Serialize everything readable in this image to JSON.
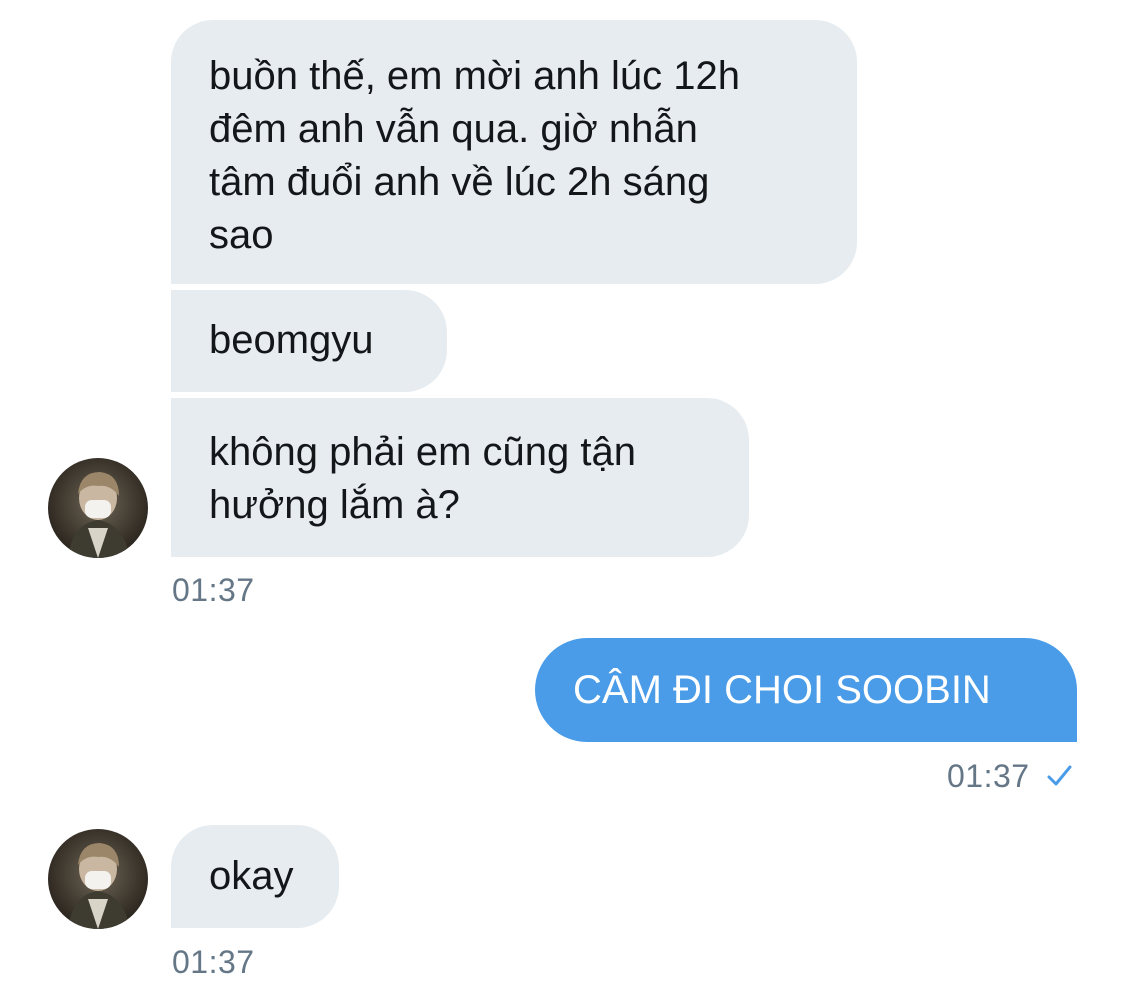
{
  "conversation": {
    "messages": [
      {
        "id": "m1",
        "direction": "incoming",
        "text": "buồn thế, em mời anh lúc 12h\nđêm anh vẫn qua. giờ nhẫn\ntâm đuổi anh về lúc 2h sáng\nsao"
      },
      {
        "id": "m2",
        "direction": "incoming",
        "text": "beomgyu"
      },
      {
        "id": "m3",
        "direction": "incoming",
        "text": "không phải em cũng tận\nhưởng lắm à?"
      },
      {
        "id": "m4",
        "direction": "outgoing",
        "text": "CÂM ĐI CHOI SOOBIN"
      },
      {
        "id": "m5",
        "direction": "incoming",
        "text": "okay"
      }
    ],
    "timestamps": {
      "group1": "01:37",
      "outgoing": "01:37",
      "group2": "01:37"
    },
    "status_icon": "checkmark-icon",
    "avatar_icon": "user-avatar"
  },
  "colors": {
    "incoming_bubble": "#e6ecf0",
    "outgoing_bubble": "#4a9ce8",
    "incoming_text": "#14171a",
    "outgoing_text": "#ffffff",
    "timestamp": "#657786",
    "check": "#4a9ce8"
  }
}
